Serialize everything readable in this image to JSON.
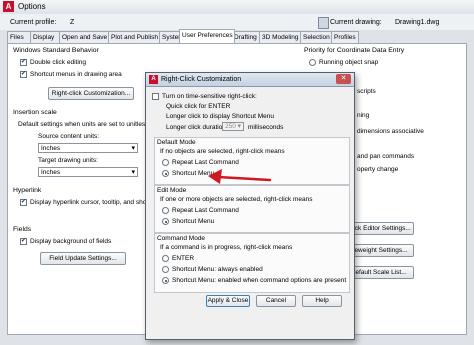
{
  "window": {
    "title": "Options",
    "logo": "A"
  },
  "profile": {
    "label": "Current profile:",
    "value": "Z",
    "drawing_label": "Current drawing:",
    "drawing_value": "Drawing1.dwg"
  },
  "tabs": [
    "Files",
    "Display",
    "Open and Save",
    "Plot and Publish",
    "System",
    "User Preferences",
    "Drafting",
    "3D Modeling",
    "Selection",
    "Profiles"
  ],
  "active_tab": "User Preferences",
  "left": {
    "windows_std": {
      "title": "Windows Standard Behavior",
      "double_click": "Double click editing",
      "shortcut_menus": "Shortcut menus in drawing area",
      "rc_button": "Right-click Customization..."
    },
    "insertion": {
      "title": "Insertion scale",
      "desc": "Default settings when units are set to unitless",
      "source_label": "Source content units:",
      "source_value": "Inches",
      "target_label": "Target drawing units:",
      "target_value": "Inches"
    },
    "hyperlink": {
      "title": "Hyperlink",
      "display": "Display hyperlink cursor, tooltip, and shortcut"
    },
    "fields": {
      "title": "Fields",
      "display_bg": "Display background of fields",
      "update_btn": "Field Update Settings..."
    }
  },
  "right": {
    "priority_title": "Priority for Coordinate Data Entry",
    "running_snap": "Running object snap",
    "fragments": [
      "scripts",
      "ning",
      "dimensions associative",
      "and pan commands",
      "operty change"
    ],
    "btn_block_editor": "ock Editor Settings...",
    "btn_lineweight": "eweight Settings...",
    "btn_scale_list": "efault Scale List..."
  },
  "dialog": {
    "title": "Right-Click Customization",
    "close": "✕",
    "time_sensitive": "Turn on time-sensitive right-click:",
    "quick_click": "Quick click for ENTER",
    "longer_click": "Longer click to display Shortcut Menu",
    "duration_label": "Longer click duration:",
    "duration_value": "250",
    "duration_unit": "milliseconds",
    "default_mode": {
      "title": "Default Mode",
      "desc": "If no objects are selected, right-click means",
      "opt1": "Repeat Last Command",
      "opt2": "Shortcut Menu"
    },
    "edit_mode": {
      "title": "Edit Mode",
      "desc": "If one or more objects are selected, right-click means",
      "opt1": "Repeat Last Command",
      "opt2": "Shortcut Menu"
    },
    "command_mode": {
      "title": "Command Mode",
      "desc": "If a command is in progress, right-click means",
      "opt1": "ENTER",
      "opt2": "Shortcut Menu: always enabled",
      "opt3": "Shortcut Menu: enabled when command options are present"
    },
    "apply_close": "Apply & Close",
    "cancel": "Cancel",
    "help": "Help"
  },
  "colors": {
    "accent": "#c8102e",
    "arrow": "#d0181f"
  },
  "icons": {
    "app": "autocad-logo",
    "drawing": "drawing-file-icon",
    "arrow": "red-arrow-annotation"
  }
}
